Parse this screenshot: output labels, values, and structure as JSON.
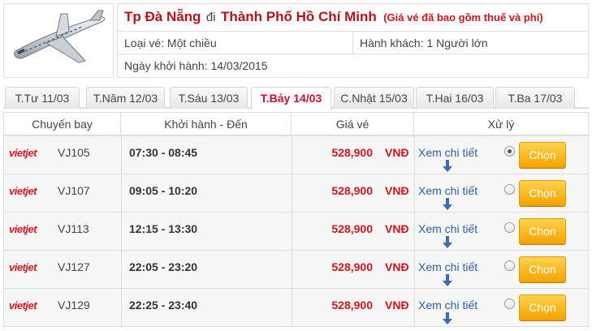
{
  "header": {
    "from_city": "Tp Đà Nẵng",
    "connector": "đi",
    "to_city": "Thành Phố Hồ Chí Minh",
    "note": "(Giá vé đã bao gồm thuế và phí)",
    "ticket_type": "Loại vé: Một chiều",
    "passengers": "Hành khách: 1 Người lớn",
    "departure_date": "Ngày khởi hành: 14/03/2015"
  },
  "tabs": [
    {
      "label": "T.Tư 11/03",
      "active": false
    },
    {
      "label": "T.Năm 12/03",
      "active": false
    },
    {
      "label": "T.Sáu 13/03",
      "active": false
    },
    {
      "label": "T.Bảy 14/03",
      "active": true
    },
    {
      "label": "C.Nhật 15/03",
      "active": false
    },
    {
      "label": "T.Hai 16/03",
      "active": false
    },
    {
      "label": "T.Ba 17/03",
      "active": false
    }
  ],
  "table": {
    "headers": [
      "Chuyến bay",
      "Khởi hành - Đến",
      "Giá vé",
      "Xử lý"
    ],
    "rows": [
      {
        "airline": "vietjet",
        "code": "VJ105",
        "time": "07:30 - 08:45",
        "price": "528,900",
        "currency": "VNĐ",
        "detail": "Xem chi tiết",
        "button": "Chọn",
        "selected": true
      },
      {
        "airline": "vietjet",
        "code": "VJ107",
        "time": "09:05 - 10:20",
        "price": "528,900",
        "currency": "VNĐ",
        "detail": "Xem chi tiết",
        "button": "Chọn",
        "selected": false
      },
      {
        "airline": "vietjet",
        "code": "VJ113",
        "time": "12:15 - 13:30",
        "price": "528,900",
        "currency": "VNĐ",
        "detail": "Xem chi tiết",
        "button": "Chọn",
        "selected": false
      },
      {
        "airline": "vietjet",
        "code": "VJ127",
        "time": "22:05 - 23:20",
        "price": "528,900",
        "currency": "VNĐ",
        "detail": "Xem chi tiết",
        "button": "Chọn",
        "selected": false
      },
      {
        "airline": "vietjet",
        "code": "VJ129",
        "time": "22:25 - 23:40",
        "price": "528,900",
        "currency": "VNĐ",
        "detail": "Xem chi tiết",
        "button": "Chọn",
        "selected": false
      }
    ]
  },
  "colors": {
    "accent_red": "#d4141d",
    "link_blue": "#2a5db0",
    "button_orange": "#f5a300"
  },
  "icons": {
    "plane": "airplane-icon",
    "arrow": "arrow-down-icon"
  }
}
